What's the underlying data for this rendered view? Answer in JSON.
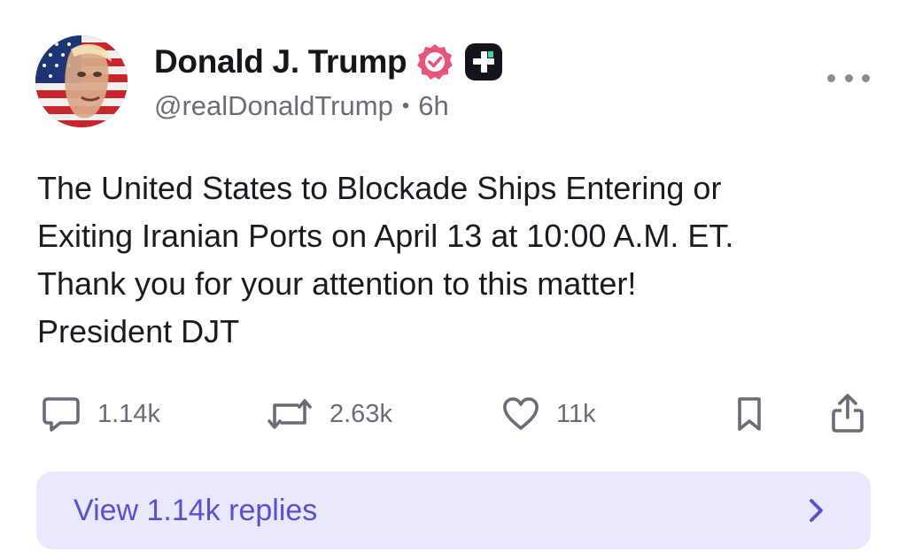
{
  "post": {
    "author": {
      "display_name": "Donald J. Trump",
      "handle": "@realDonaldTrump",
      "time_ago": "6h",
      "separator": "•",
      "avatar_icon": "avatar-flag-portrait",
      "verified_icon": "verified-badge-icon",
      "plus_icon": "truth-plus-icon"
    },
    "body_lines": [
      "The United States to Blockade Ships Entering or",
      "Exiting Iranian Ports on April 13 at 10:00 A.M. ET.",
      "Thank you for your attention to this matter!",
      "President DJT"
    ],
    "actions": {
      "replies": {
        "icon": "comment-icon",
        "count": "1.14k"
      },
      "retruths": {
        "icon": "repost-icon",
        "count": "2.63k"
      },
      "likes": {
        "icon": "heart-icon",
        "count": "11k"
      },
      "bookmark": {
        "icon": "bookmark-icon"
      },
      "share": {
        "icon": "share-icon"
      }
    },
    "view_replies": {
      "label": "View 1.14k replies",
      "icon": "chevron-right-icon"
    }
  },
  "colors": {
    "verified_badge": "#e8547a",
    "plus_badge": "#14141c",
    "muted_text": "#6b6b78",
    "replies_bg": "#e9e8fd",
    "replies_text": "#5b4fcf"
  }
}
